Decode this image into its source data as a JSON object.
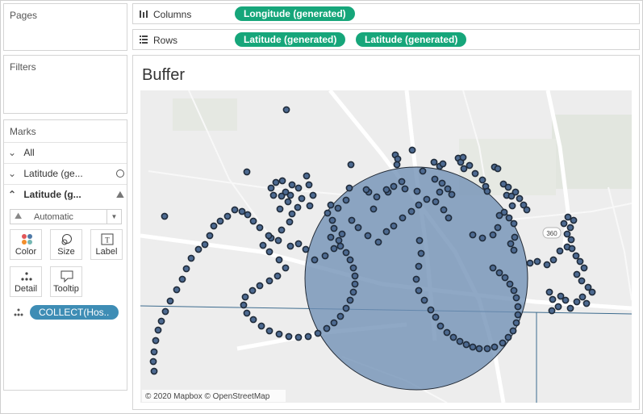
{
  "pages_title": "Pages",
  "filters_title": "Filters",
  "marks": {
    "title": "Marks",
    "all_label": "All",
    "layer1_label": "Latitude (ge...",
    "layer2_label": "Latitude (g...",
    "mark_type": "Automatic",
    "buttons": {
      "color": "Color",
      "size": "Size",
      "label": "Label",
      "detail": "Detail",
      "tooltip": "Tooltip"
    },
    "collect_pill": "COLLECT(Hos.."
  },
  "columns": {
    "label": "Columns",
    "pill": "Longitude (generated)"
  },
  "rows": {
    "label": "Rows",
    "pill1": "Latitude (generated)",
    "pill2": "Latitude (generated)"
  },
  "viz": {
    "title": "Buffer",
    "attribution": "© 2020 Mapbox © OpenStreetMap",
    "highway_shield": "360"
  },
  "colors": {
    "pill_green": "#16a67a",
    "buffer_fill": "#6f8fb5",
    "point_fill": "#4d6a91"
  }
}
